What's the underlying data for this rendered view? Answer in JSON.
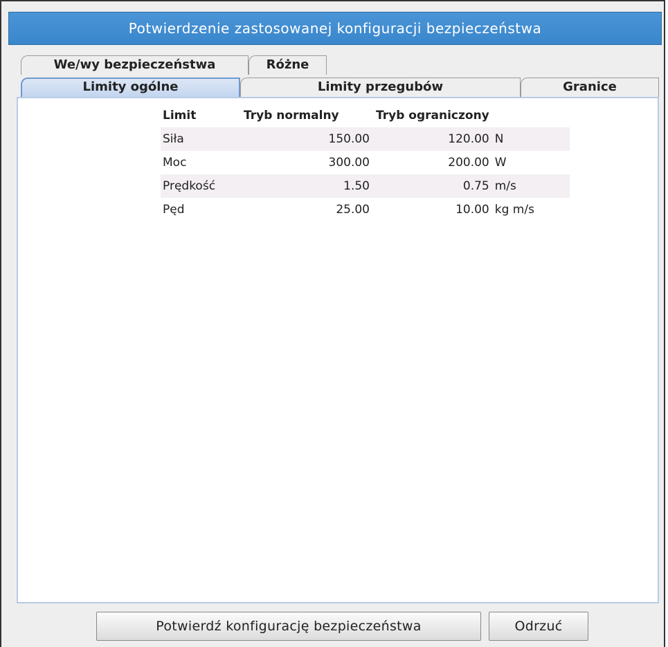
{
  "dialog": {
    "title": "Potwierdzenie zastosowanej konfiguracji bezpieczeństwa"
  },
  "tabs": {
    "row_back": [
      {
        "label": "We/wy bezpieczeństwa"
      },
      {
        "label": "Różne"
      }
    ],
    "row_front": [
      {
        "label": "Limity ogólne",
        "selected": true
      },
      {
        "label": "Limity przegubów"
      },
      {
        "label": "Granice"
      }
    ]
  },
  "table": {
    "headers": [
      "Limit",
      "Tryb normalny",
      "Tryb ograniczony",
      ""
    ],
    "rows": [
      {
        "name": "Siła",
        "normal": "150.00",
        "reduced": "120.00",
        "unit": "N"
      },
      {
        "name": "Moc",
        "normal": "300.00",
        "reduced": "200.00",
        "unit": "W"
      },
      {
        "name": "Prędkość",
        "normal": "1.50",
        "reduced": "0.75",
        "unit": "m/s"
      },
      {
        "name": "Pęd",
        "normal": "25.00",
        "reduced": "10.00",
        "unit": "kg m/s"
      }
    ]
  },
  "buttons": {
    "confirm": "Potwierdź konfigurację bezpieczeństwa",
    "reject": "Odrzuć"
  },
  "colors": {
    "title_bar": "#3a86cc",
    "selected_tab": "#c3d5ef",
    "row_stripe": "#f3eff2"
  }
}
